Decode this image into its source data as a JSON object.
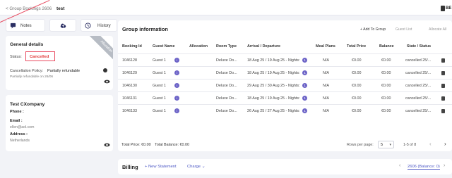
{
  "header": {
    "breadcrumb": "< Group Bookings 2606",
    "title": "test",
    "language": "BE"
  },
  "actions": {
    "notes": "Notes",
    "history": "History"
  },
  "general": {
    "title": "General details",
    "status_label": "Status:",
    "status_value": "Cancelled",
    "ribbon": "Allocation",
    "policy_label": "Cancellation Policy:",
    "policy_value": "Partially refundable",
    "policy_note": "Partially refundable on 26/06"
  },
  "company": {
    "name": "Test CXompany",
    "phone_label": "Phone :",
    "email_label": "Email :",
    "email_value": "ellen@aol.com",
    "address_label": "Address :",
    "address_value": "Netherlands"
  },
  "group": {
    "title": "Group information",
    "add_to_group": "+ Add To Group",
    "guest_list": "Guest List",
    "allocate_all": "Allocate All",
    "columns": [
      "Booking Id",
      "Guest Name",
      "Allocation",
      "Room Type",
      "Arrival / Departure",
      "Meal Plans",
      "Total Price",
      "Balance",
      "State / Status"
    ],
    "rows": [
      {
        "id": "1046128",
        "guest": "Guest 1",
        "badge": "i",
        "room": "Deluxe Do...",
        "dates": "18 Aug 25 / 19 Aug 25 - Nights:",
        "nights_badge": "1",
        "meal": "N/A",
        "price": "€0.00",
        "balance": "€0.00",
        "state": "cancelled 25/..."
      },
      {
        "id": "1046129",
        "guest": "Guest 1",
        "badge": "i",
        "room": "Deluxe Do...",
        "dates": "18 Aug 25 / 19 Aug 25 - Nights:",
        "nights_badge": "1",
        "meal": "N/A",
        "price": "€0.00",
        "balance": "€0.00",
        "state": "cancelled 25/..."
      },
      {
        "id": "1046130",
        "guest": "Guest 1",
        "badge": "i",
        "room": "Deluxe Do...",
        "dates": "29 Aug 25 / 30 Aug 25 - Nights:",
        "nights_badge": "1",
        "meal": "N/A",
        "price": "€0.00",
        "balance": "€0.00",
        "state": "cancelled 25/..."
      },
      {
        "id": "1046131",
        "guest": "Guest 1",
        "badge": "i",
        "room": "Deluxe Do...",
        "dates": "18 Aug 25 / 19 Aug 25 - Nights:",
        "nights_badge": "1",
        "meal": "N/A",
        "price": "€0.00",
        "balance": "€0.00",
        "state": "cancelled 25/..."
      },
      {
        "id": "1046133",
        "guest": "Guest 1",
        "badge": "i",
        "room": "Deluxe Do...",
        "dates": "26 Aug 25 / 27 Aug 25 - Nights:",
        "nights_badge": "1",
        "meal": "N/A",
        "price": "€0.00",
        "balance": "€0.00",
        "state": "cancelled 25/..."
      }
    ],
    "total_price": "Total Price: €0.00",
    "total_balance": "Total Balance: €0.00",
    "rows_per_page_label": "Rows per page:",
    "rows_per_page_value": "5",
    "page_info": "1-5 of 8"
  },
  "billing": {
    "title": "Billing",
    "new_statement": "+ New Statement",
    "charge": "Charge ⌄",
    "page": "2606 (Balance: 0)"
  },
  "colors": {
    "accent": "#4d58c5",
    "badge": "#6c63c7",
    "cancelled": "#e23b3b",
    "highlight_box": "#e84a5f"
  }
}
